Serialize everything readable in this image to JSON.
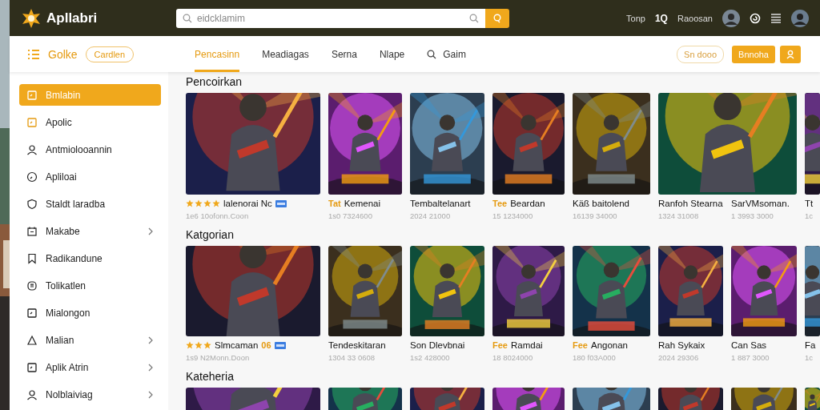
{
  "header": {
    "app_name": "Apllabri",
    "search": {
      "placeholder": "eidcklamim"
    },
    "links": [
      "Tonp",
      "1Q",
      "Raoosan"
    ]
  },
  "toolbar": {
    "title": "Golke",
    "tag": "Cardlen",
    "tabs": [
      {
        "label": "Pencasinn",
        "selected": true,
        "kind": "text"
      },
      {
        "label": "Meadiagas",
        "selected": false,
        "kind": "text"
      },
      {
        "label": "Serna",
        "selected": false,
        "kind": "text"
      },
      {
        "label": "Nlape",
        "selected": false,
        "kind": "text"
      },
      {
        "label": "Gaim",
        "selected": false,
        "kind": "search"
      }
    ],
    "buttons": [
      {
        "label": "Sn dooo",
        "kind": "outline"
      },
      {
        "label": "Bnnoha",
        "kind": "filled"
      }
    ]
  },
  "sidebar": {
    "items": [
      {
        "label": "Bmlabin",
        "selected": true,
        "has_submenu": false
      },
      {
        "label": "Apolic",
        "selected": false,
        "has_submenu": false
      },
      {
        "label": "Antmiolooannin",
        "selected": false,
        "has_submenu": false
      },
      {
        "label": "Apliloai",
        "selected": false,
        "has_submenu": false
      },
      {
        "label": "Staldt laradba",
        "selected": false,
        "has_submenu": false
      },
      {
        "label": "Makabe",
        "selected": false,
        "has_submenu": true
      },
      {
        "label": "Radikandune",
        "selected": false,
        "has_submenu": false
      },
      {
        "label": "Tolikatlen",
        "selected": false,
        "has_submenu": false
      },
      {
        "label": "Mialongon",
        "selected": false,
        "has_submenu": false
      },
      {
        "label": "Malian",
        "selected": false,
        "has_submenu": true
      },
      {
        "label": "Aplik Atrin",
        "selected": false,
        "has_submenu": true
      },
      {
        "label": "Nolblaiviag",
        "selected": false,
        "has_submenu": true
      }
    ]
  },
  "sections": [
    {
      "title": "Pencoirkan",
      "tiles": [
        {
          "kind": "single"
        },
        {
          "kind": "single"
        },
        {
          "kind": "single"
        },
        {
          "kind": "single"
        },
        {
          "kind": "single"
        },
        {
          "kind": "double"
        },
        {
          "kind": "single"
        }
      ],
      "apps": [
        {
          "stars": 4,
          "name": "lalenorai Nc",
          "badge": true,
          "subtitle": "1e6 10ofonn.Coon"
        },
        {
          "tag": "Tat",
          "name": "Kemenai",
          "badge": false,
          "subtitle": "1s0 7324600"
        },
        {
          "name": "Tembaltelanart",
          "badge": false,
          "subtitle": "2024 21000"
        },
        {
          "tag": "Tee",
          "name": "Beardan",
          "badge": false,
          "subtitle": "15 1234000"
        },
        {
          "name": "Käß baitolend",
          "badge": false,
          "subtitle": "16139 34000"
        },
        {
          "name": "Ranfoh Stearna",
          "badge": false,
          "subtitle": "1324 31008"
        },
        {
          "name": "SarVMsoman.",
          "badge": false,
          "subtitle": "1 3993 3000"
        },
        {
          "name": "Tt",
          "badge": false,
          "subtitle": "1c"
        }
      ]
    },
    {
      "title": "Katgorian",
      "tiles": [
        {
          "kind": "single"
        },
        {
          "kind": "single"
        },
        {
          "kind": "single"
        },
        {
          "kind": "single"
        },
        {
          "kind": "single"
        },
        {
          "kind": "single"
        },
        {
          "kind": "single"
        },
        {
          "kind": "single"
        }
      ],
      "apps": [
        {
          "stars": 3,
          "name": "Slmcaman",
          "tag_after": "06",
          "badge": true,
          "subtitle": "1s9 N2Monn.Doon"
        },
        {
          "name": "Tendeskitaran",
          "badge": false,
          "subtitle": "1304 33 0608"
        },
        {
          "name": "Son Dlevbnai",
          "badge": false,
          "subtitle": "1s2 428000"
        },
        {
          "tag": "Fee",
          "name": "Ramdai",
          "badge": false,
          "subtitle": "18 8024000"
        },
        {
          "tag": "Fee",
          "name": "Angonan",
          "badge": false,
          "subtitle": "180 f03A000"
        },
        {
          "name": "Rah Sykaix",
          "badge": false,
          "subtitle": "2024 29306"
        },
        {
          "name": "Can Sas",
          "badge": false,
          "subtitle": "1 887 3000"
        },
        {
          "name": "Fa",
          "badge": false,
          "subtitle": "1c"
        }
      ]
    },
    {
      "title": "Kateheria",
      "tiles": [
        {
          "kind": "single"
        },
        {
          "kind": "single"
        },
        {
          "kind": "single"
        },
        {
          "kind": "single"
        },
        {
          "kind": "single"
        },
        {
          "kind": "single"
        },
        {
          "kind": "single"
        },
        {
          "kind": "single"
        }
      ]
    }
  ]
}
